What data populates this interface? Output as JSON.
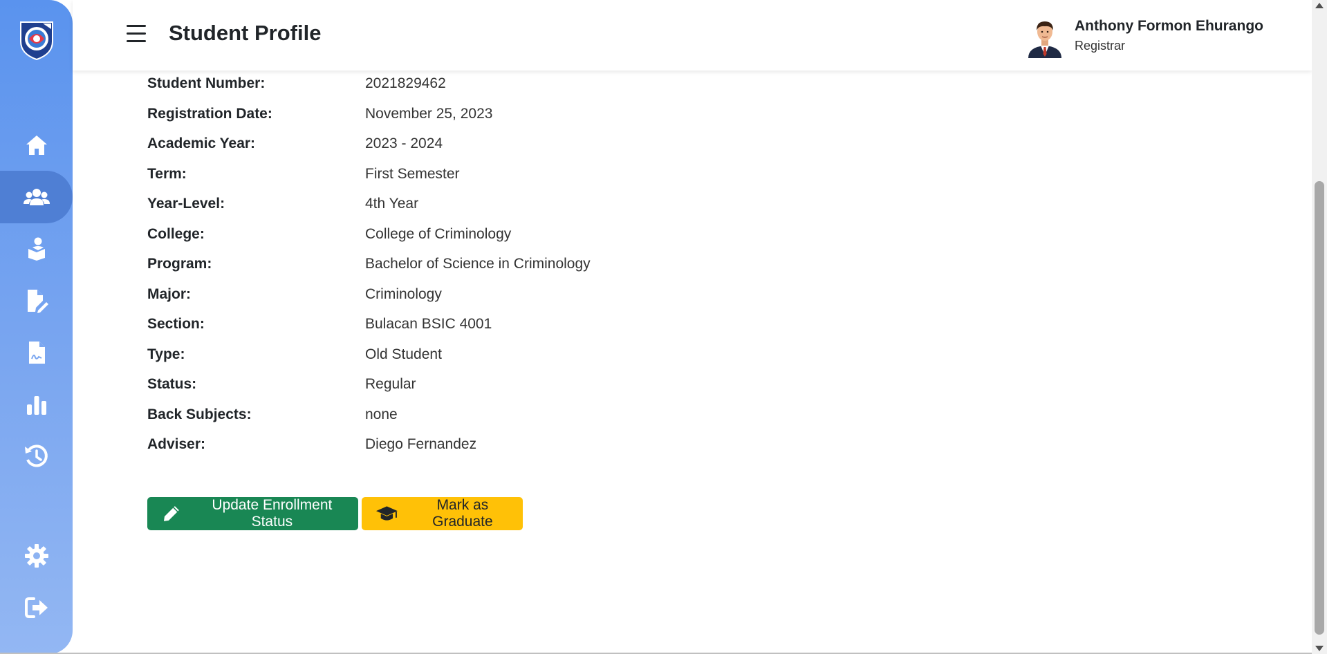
{
  "header": {
    "title": "Student Profile",
    "user_name": "Anthony Formon Ehurango",
    "user_role": "Registrar"
  },
  "sidebar": {
    "items": [
      {
        "icon": "home-icon",
        "active": false
      },
      {
        "icon": "users-icon",
        "active": true
      },
      {
        "icon": "student-reading-icon",
        "active": false
      },
      {
        "icon": "file-edit-icon",
        "active": false
      },
      {
        "icon": "file-signature-icon",
        "active": false
      },
      {
        "icon": "bar-chart-icon",
        "active": false
      },
      {
        "icon": "history-icon",
        "active": false
      },
      {
        "icon": "gear-icon",
        "active": false
      },
      {
        "icon": "logout-icon",
        "active": false
      }
    ]
  },
  "profile": {
    "fields": [
      {
        "label": "Student Number:",
        "value": "2021829462"
      },
      {
        "label": "Registration Date:",
        "value": "November 25, 2023"
      },
      {
        "label": "Academic Year:",
        "value": "2023 - 2024"
      },
      {
        "label": "Term:",
        "value": "First Semester"
      },
      {
        "label": "Year-Level:",
        "value": "4th Year"
      },
      {
        "label": "College:",
        "value": "College of Criminology"
      },
      {
        "label": "Program:",
        "value": "Bachelor of Science in Criminology"
      },
      {
        "label": "Major:",
        "value": "Criminology"
      },
      {
        "label": "Section:",
        "value": "Bulacan BSIC 4001"
      },
      {
        "label": "Type:",
        "value": "Old Student"
      },
      {
        "label": "Status:",
        "value": "Regular"
      },
      {
        "label": "Back Subjects:",
        "value": "none"
      },
      {
        "label": "Adviser:",
        "value": "Diego Fernandez"
      }
    ]
  },
  "actions": {
    "update_label": "Update Enrollment Status",
    "graduate_label": "Mark as Graduate"
  },
  "colors": {
    "sidebar_top": "#5a93ee",
    "sidebar_active": "#4f7fd4",
    "success": "#198754",
    "warning": "#ffc107"
  }
}
